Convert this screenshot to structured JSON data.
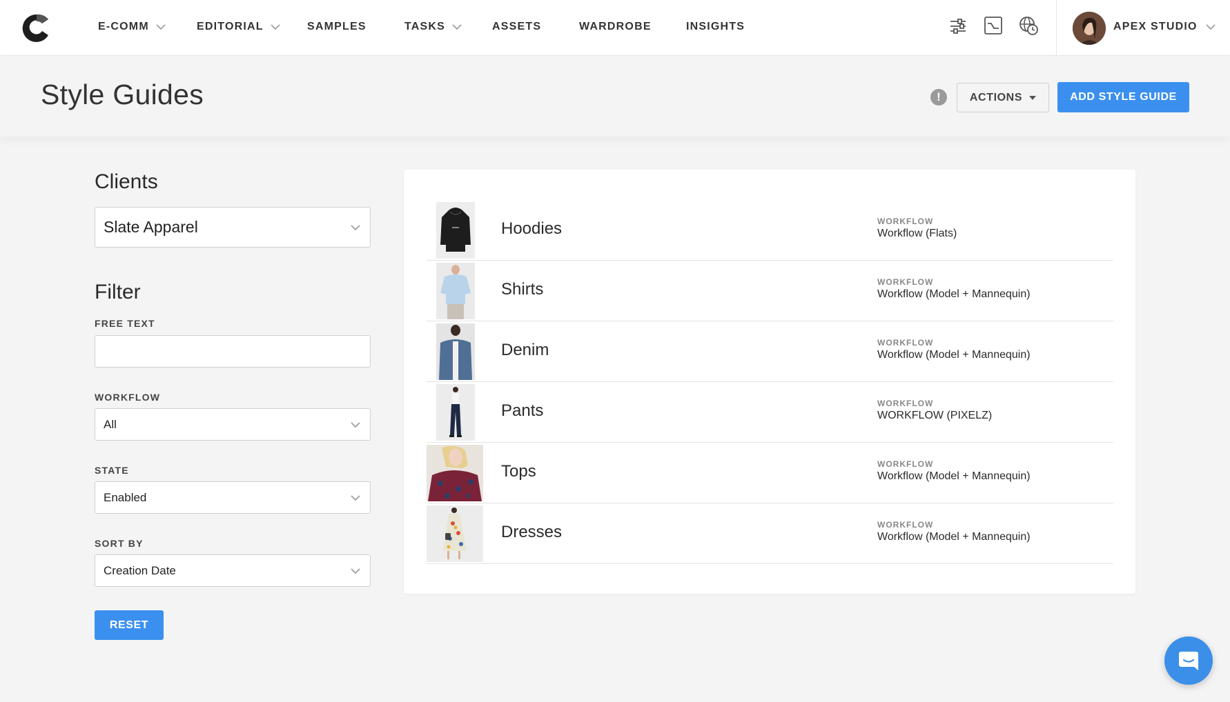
{
  "nav": {
    "logo": "c-logo-icon",
    "items": [
      {
        "label": "E-COMM",
        "has_dropdown": true
      },
      {
        "label": "EDITORIAL",
        "has_dropdown": true
      },
      {
        "label": "SAMPLES",
        "has_dropdown": false
      },
      {
        "label": "TASKS",
        "has_dropdown": true
      },
      {
        "label": "ASSETS",
        "has_dropdown": false
      },
      {
        "label": "WARDROBE",
        "has_dropdown": false
      },
      {
        "label": "INSIGHTS",
        "has_dropdown": false
      }
    ],
    "icons": [
      "sliders-icon",
      "chart-icon",
      "globe-clock-icon"
    ],
    "user": {
      "name": "APEX STUDIO"
    }
  },
  "header": {
    "title": "Style Guides",
    "info_icon": "!",
    "actions_label": "ACTIONS",
    "add_label": "ADD STYLE GUIDE"
  },
  "filters": {
    "clients_title": "Clients",
    "client_value": "Slate Apparel",
    "filter_title": "Filter",
    "free_text_label": "FREE TEXT",
    "free_text_value": "",
    "workflow_label": "WORKFLOW",
    "workflow_value": "All",
    "state_label": "STATE",
    "state_value": "Enabled",
    "sort_label": "SORT BY",
    "sort_value": "Creation Date",
    "reset_label": "RESET"
  },
  "guides": [
    {
      "name": "Hoodies",
      "workflow_label": "WORKFLOW",
      "workflow": "Workflow (Flats)",
      "thumb": "hoodie-thumbnail"
    },
    {
      "name": "Shirts",
      "workflow_label": "WORKFLOW",
      "workflow": "Workflow (Model + Mannequin)",
      "thumb": "shirt-thumbnail"
    },
    {
      "name": "Denim",
      "workflow_label": "WORKFLOW",
      "workflow": "Workflow (Model + Mannequin)",
      "thumb": "denim-thumbnail"
    },
    {
      "name": "Pants",
      "workflow_label": "WORKFLOW",
      "workflow": "WORKFLOW (PIXELZ)",
      "thumb": "pants-thumbnail"
    },
    {
      "name": "Tops",
      "workflow_label": "WORKFLOW",
      "workflow": "Workflow (Model + Mannequin)",
      "thumb": "top-thumbnail"
    },
    {
      "name": "Dresses",
      "workflow_label": "WORKFLOW",
      "workflow": "Workflow (Model + Mannequin)",
      "thumb": "dress-thumbnail"
    }
  ],
  "colors": {
    "accent": "#3b90ef",
    "background": "#f4f4f4",
    "card": "#ffffff"
  },
  "chat": {
    "icon": "chat-bubble-icon"
  }
}
